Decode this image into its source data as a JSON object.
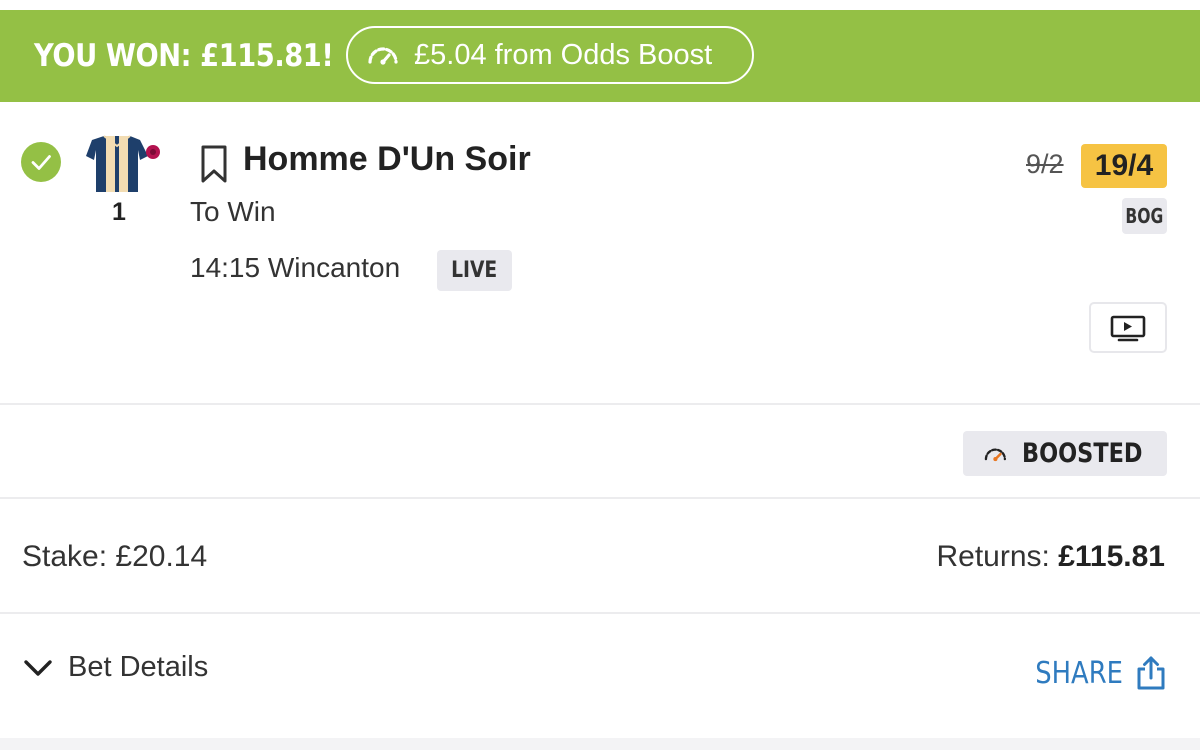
{
  "banner": {
    "won_text": "YOU WON: £115.81!",
    "boost_text": "£5.04 from Odds Boost",
    "icon": "speedometer-icon",
    "color": "#94c045"
  },
  "selection": {
    "status_icon": "check-circle-icon",
    "runner_number": "1",
    "runner_name": "Homme D'Un Soir",
    "market": "To Win",
    "race": "14:15 Wincanton",
    "live_label": "LIVE",
    "old_odds": "9/2",
    "new_odds": "19/4",
    "bog_label": "BOG",
    "watch_icon": "play-video-icon"
  },
  "boosted": {
    "label": "BOOSTED",
    "icon": "speedometer-icon"
  },
  "summary": {
    "stake_label": "Stake:",
    "stake_value": "£20.14",
    "returns_label": "Returns:",
    "returns_value": "£115.81"
  },
  "footer": {
    "details_label": "Bet Details",
    "share_label": "SHARE",
    "share_color": "#2f7bbf"
  }
}
